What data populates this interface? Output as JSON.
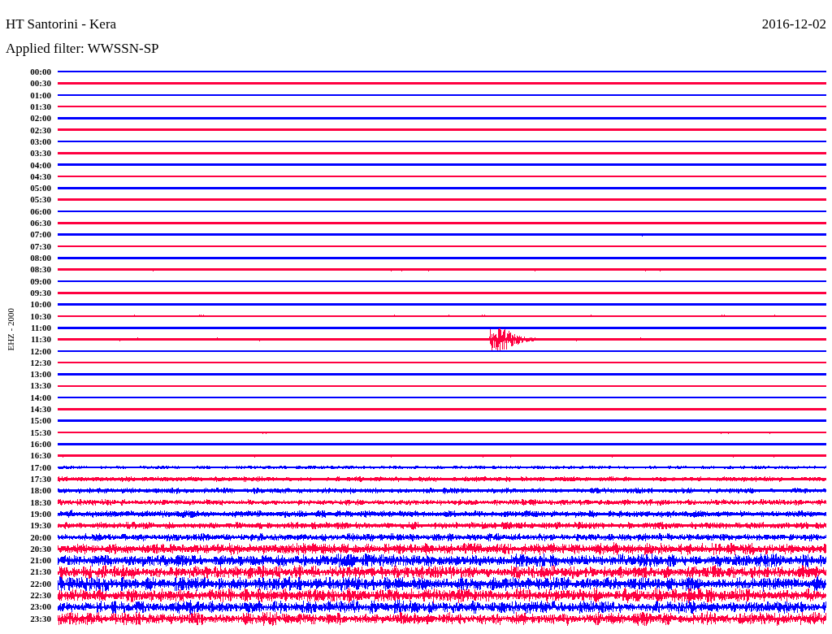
{
  "header": {
    "title": "HT Santorini - Kera",
    "date": "2016-12-02",
    "filter": "Applied filter: WWSSN-SP"
  },
  "channel_label": "EHZ - 2000",
  "traces": [
    {
      "time": "00:00",
      "color": "#0000ff"
    },
    {
      "time": "00:30",
      "color": "#ff0040"
    },
    {
      "time": "01:00",
      "color": "#0000ff"
    },
    {
      "time": "01:30",
      "color": "#ff0040"
    },
    {
      "time": "02:00",
      "color": "#0000ff"
    },
    {
      "time": "02:30",
      "color": "#ff0040"
    },
    {
      "time": "03:00",
      "color": "#0000ff"
    },
    {
      "time": "03:30",
      "color": "#ff0040"
    },
    {
      "time": "04:00",
      "color": "#0000ff"
    },
    {
      "time": "04:30",
      "color": "#ff0040"
    },
    {
      "time": "05:00",
      "color": "#0000ff"
    },
    {
      "time": "05:30",
      "color": "#ff0040"
    },
    {
      "time": "06:00",
      "color": "#0000ff"
    },
    {
      "time": "06:30",
      "color": "#ff0040"
    },
    {
      "time": "07:00",
      "color": "#0000ff"
    },
    {
      "time": "07:30",
      "color": "#ff0040"
    },
    {
      "time": "08:00",
      "color": "#0000ff"
    },
    {
      "time": "08:30",
      "color": "#ff0040"
    },
    {
      "time": "09:00",
      "color": "#0000ff"
    },
    {
      "time": "09:30",
      "color": "#ff0040"
    },
    {
      "time": "10:00",
      "color": "#0000ff"
    },
    {
      "time": "10:30",
      "color": "#ff0040"
    },
    {
      "time": "11:00",
      "color": "#0000ff"
    },
    {
      "time": "11:30",
      "color": "#ff0040"
    },
    {
      "time": "12:00",
      "color": "#0000ff"
    },
    {
      "time": "12:30",
      "color": "#ff0040"
    },
    {
      "time": "13:00",
      "color": "#0000ff"
    },
    {
      "time": "13:30",
      "color": "#ff0040"
    },
    {
      "time": "14:00",
      "color": "#0000ff"
    },
    {
      "time": "14:30",
      "color": "#ff0040"
    },
    {
      "time": "15:00",
      "color": "#0000ff"
    },
    {
      "time": "15:30",
      "color": "#ff0040"
    },
    {
      "time": "16:00",
      "color": "#0000ff"
    },
    {
      "time": "16:30",
      "color": "#ff0040"
    },
    {
      "time": "17:00",
      "color": "#0000ff"
    },
    {
      "time": "17:30",
      "color": "#ff0040"
    },
    {
      "time": "18:00",
      "color": "#0000ff"
    },
    {
      "time": "18:30",
      "color": "#ff0040"
    },
    {
      "time": "19:00",
      "color": "#0000ff"
    },
    {
      "time": "19:30",
      "color": "#ff0040"
    },
    {
      "time": "20:00",
      "color": "#0000ff"
    },
    {
      "time": "20:30",
      "color": "#ff0040"
    },
    {
      "time": "21:00",
      "color": "#0000ff"
    },
    {
      "time": "21:30",
      "color": "#ff0040"
    },
    {
      "time": "22:00",
      "color": "#0000ff"
    },
    {
      "time": "22:30",
      "color": "#ff0040"
    },
    {
      "time": "23:00",
      "color": "#0000ff"
    },
    {
      "time": "23:30",
      "color": "#ff0040"
    }
  ]
}
